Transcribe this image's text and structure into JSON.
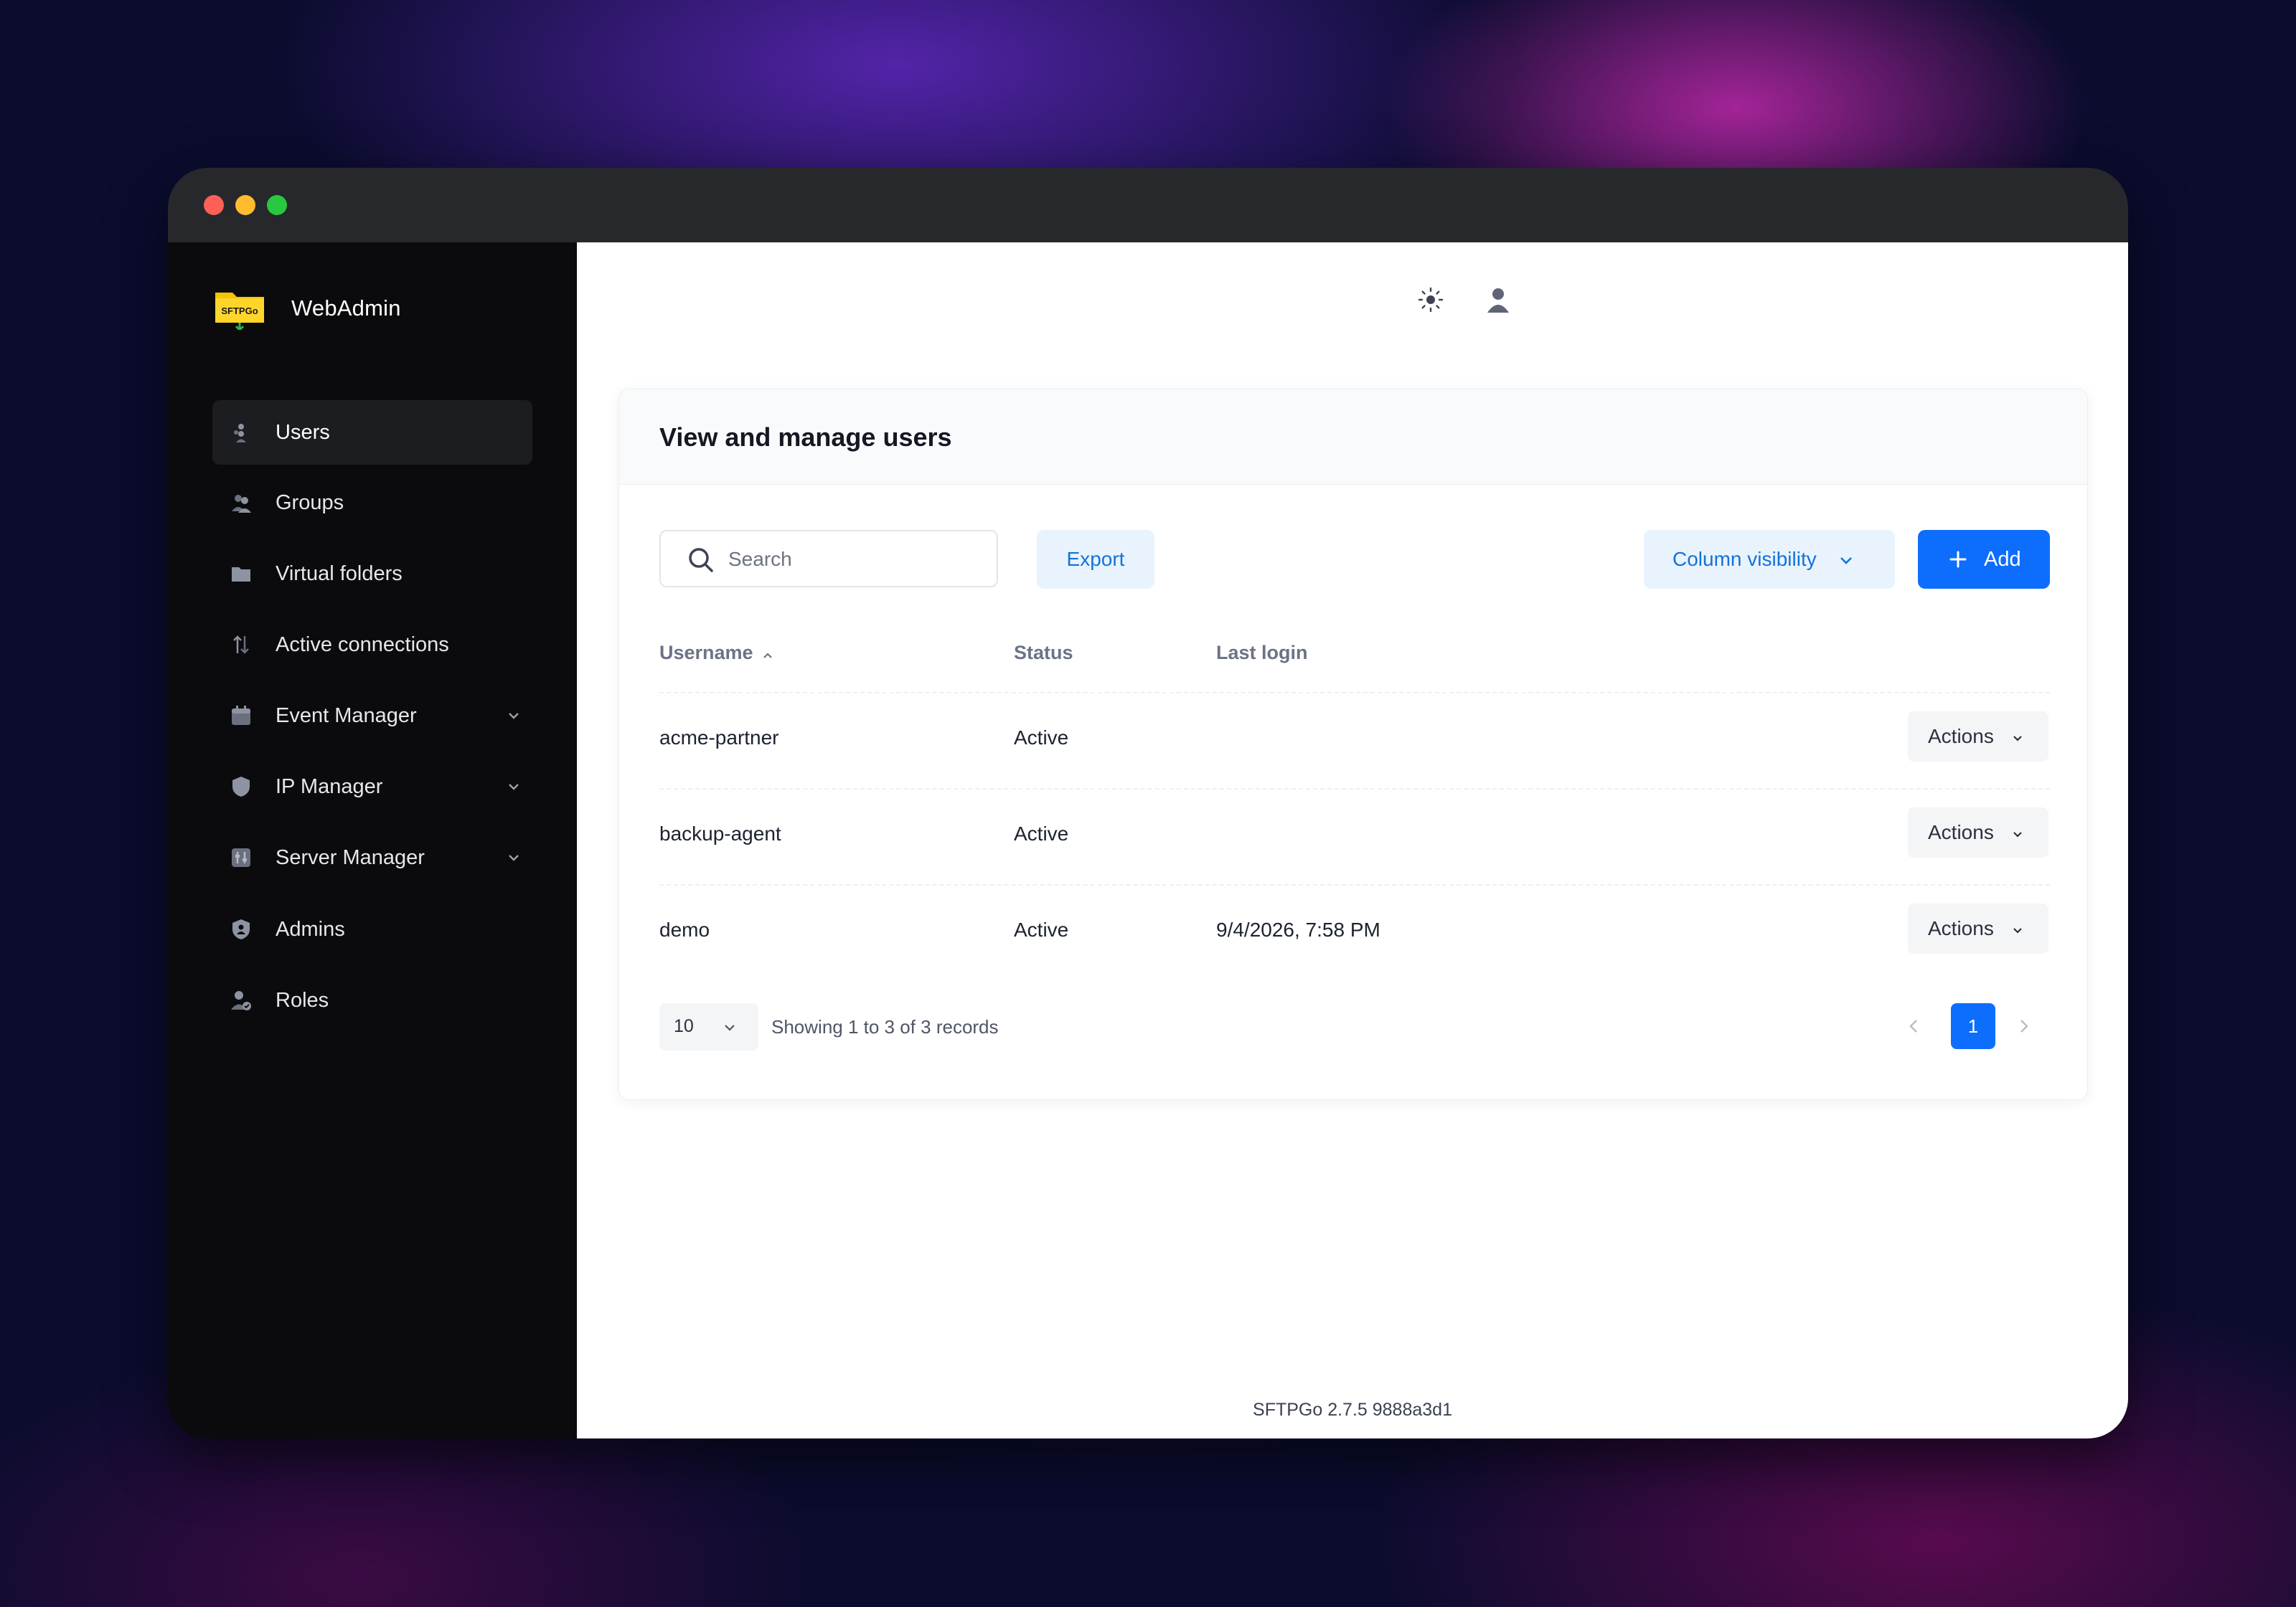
{
  "app": {
    "title": "WebAdmin",
    "logo_text": "SFTPGo"
  },
  "sidebar": {
    "items": [
      {
        "label": "Users",
        "icon": "users-icon",
        "active": true
      },
      {
        "label": "Groups",
        "icon": "groups-icon"
      },
      {
        "label": "Virtual folders",
        "icon": "folder-icon"
      },
      {
        "label": "Active connections",
        "icon": "arrows-up-down-icon"
      },
      {
        "label": "Event Manager",
        "icon": "calendar-icon",
        "expandable": true
      },
      {
        "label": "IP Manager",
        "icon": "shield-icon",
        "expandable": true
      },
      {
        "label": "Server Manager",
        "icon": "server-settings-icon",
        "expandable": true
      },
      {
        "label": "Admins",
        "icon": "admin-shield-icon"
      },
      {
        "label": "Roles",
        "icon": "user-check-icon"
      }
    ]
  },
  "header": {
    "theme_icon": "sun-icon",
    "account_icon": "user-icon"
  },
  "card": {
    "title": "View and manage users",
    "search_placeholder": "Search",
    "export_label": "Export",
    "column_visibility_label": "Column visibility",
    "add_label": "Add"
  },
  "table": {
    "columns": [
      "Username",
      "Status",
      "Last login"
    ],
    "sort_column": "Username",
    "sort_direction": "ascending",
    "action_label": "Actions",
    "rows": [
      {
        "username": "acme-partner",
        "status": "Active",
        "last_login": ""
      },
      {
        "username": "backup-agent",
        "status": "Active",
        "last_login": ""
      },
      {
        "username": "demo",
        "status": "Active",
        "last_login": "9/4/2026, 7:58 PM"
      }
    ]
  },
  "pagination": {
    "page_size": "10",
    "info": "Showing 1 to 3 of 3 records",
    "current_page": "1"
  },
  "footer": {
    "version": "SFTPGo 2.7.5 9888a3d1"
  },
  "colors": {
    "primary": "#0d6efd",
    "sidebar_bg": "#0b0b0d",
    "sidebar_active": "#1c1d21",
    "titlebar": "#27282c",
    "light_button_bg": "#e9f3fd",
    "light_button_text": "#1472d8"
  }
}
